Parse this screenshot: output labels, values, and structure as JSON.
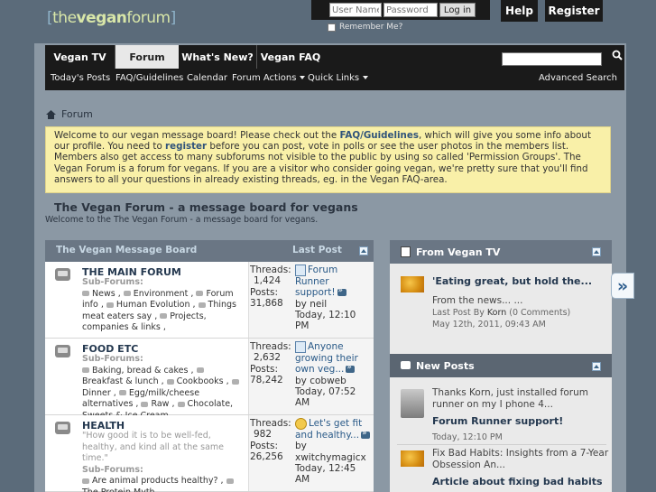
{
  "logo": {
    "open": "[",
    "pre": "the",
    "brand": "vegan",
    "post": "forum",
    "close": "]"
  },
  "login": {
    "username_placeholder": "User Name",
    "password_placeholder": "Password",
    "button": "Log in",
    "remember": "Remember Me?"
  },
  "topbar": {
    "help": "Help",
    "register": "Register"
  },
  "nav": {
    "tabs": [
      "Vegan TV",
      "Forum",
      "What's New?",
      "Vegan FAQ"
    ],
    "active": "Forum",
    "subnav": [
      "Today's Posts",
      "FAQ/Guidelines",
      "Calendar",
      "Forum Actions",
      "Quick Links"
    ],
    "advanced_search": "Advanced Search"
  },
  "breadcrumb": "Forum",
  "notice": {
    "p1": "Welcome to our vegan message board! Please check out the ",
    "link1": "FAQ/Guidelines",
    "p2": ", which will give you some info about our profile. You need to ",
    "link2": "register",
    "p3": " before you can post, vote in polls or see the user photos in the members list. Members also get access to many subforums not visible to the public by using so called 'Permission Groups'. The Vegan Forum is a forum for vegans. If you are a visitor who consider going vegan, we're pretty sure that you'll find answers to all your questions in already existing threads, eg. in the Vegan FAQ-area."
  },
  "forum_title": "The Vegan Forum - a message board for vegans",
  "forum_desc": "Welcome to the   The Vegan Forum - a message board for vegans.",
  "board": {
    "title": "The Vegan Message Board",
    "last_post": "Last Post",
    "subforums_label": "Sub-Forums:",
    "threads_label": "Threads:",
    "posts_label": "Posts:",
    "by_label": "by",
    "forums": [
      {
        "name": "THE MAIN FORUM",
        "desc": "",
        "subforums": [
          "News",
          "Environment",
          "Forum info",
          "Human Evolution",
          "Things meat eaters say",
          "Projects, companies & links"
        ],
        "threads": "1,424",
        "posts": "31,868",
        "last_title": "Forum Runner support!",
        "last_by": "neil",
        "last_date": "Today,",
        "last_time": "12:10 PM"
      },
      {
        "name": "FOOD ETC",
        "desc": "",
        "subforums": [
          "Baking, bread & cakes",
          "Breakfast & lunch",
          "Cookbooks",
          "Dinner",
          "Egg/milk/cheese alternatives",
          "Raw",
          "Chocolate, Sweets & Ice Cream"
        ],
        "threads": "2,632",
        "posts": "78,242",
        "last_title": "Anyone growing their own veg...",
        "last_by": "cobweb",
        "last_date": "Today,",
        "last_time": "07:52 AM"
      },
      {
        "name": "HEALTH",
        "desc": "\"How good it is to be well-fed, healthy, and kind all at the same time.\"",
        "subforums": [
          "Are animal products healthy?",
          "The Protein Myth"
        ],
        "threads": "982",
        "posts": "26,256",
        "last_title": "Let's get fit and healthy...",
        "last_by": "xwitchymagicx",
        "last_date": "Today,",
        "last_time": "12:45 AM"
      }
    ]
  },
  "vegan_tv": {
    "title": "From Vegan TV",
    "item_title": "'Eating great, but hold the...",
    "excerpt": "From the news... ...",
    "last_post_by": "Last Post By",
    "author": "Korn",
    "comments": "(0 Comments)",
    "date": "May 12th, 2011, 09:43 AM"
  },
  "new_posts": {
    "title": "New Posts",
    "items": [
      {
        "excerpt": "Thanks Korn, just installed forum runner on my I phone 4...",
        "title": "Forum Runner support!",
        "date": "Today, 12:10 PM"
      },
      {
        "excerpt": "Fix Bad Habits: Insights from a 7-Year Obsession An...",
        "title": "Article about fixing bad habits"
      }
    ]
  },
  "side_arrow": "»"
}
